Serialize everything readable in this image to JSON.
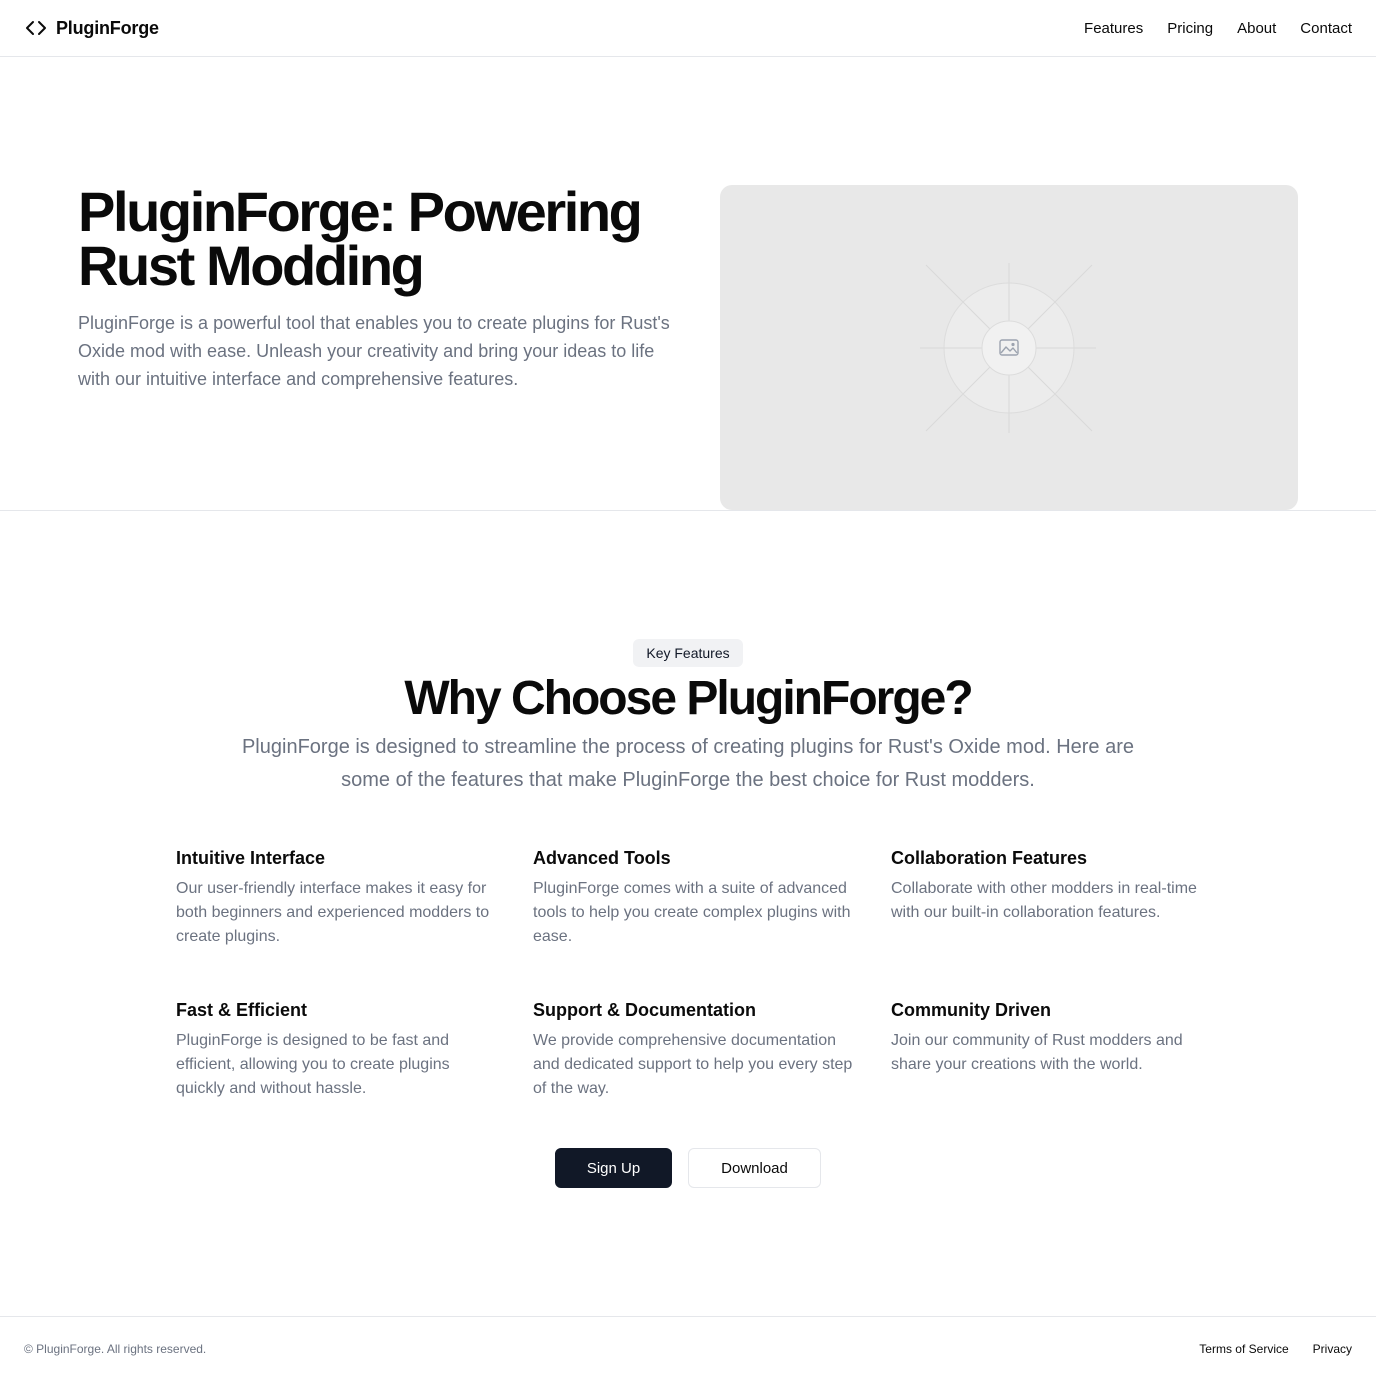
{
  "header": {
    "brand_icon": "code-brackets-icon",
    "brand_name": "PluginForge",
    "nav": [
      {
        "label": "Features"
      },
      {
        "label": "Pricing"
      },
      {
        "label": "About"
      },
      {
        "label": "Contact"
      }
    ]
  },
  "hero": {
    "title": "PluginForge: Powering Rust Modding",
    "description": "PluginForge is a powerful tool that enables you to create plugins for Rust's Oxide mod with ease. Unleash your creativity and bring your ideas to life with our intuitive interface and comprehensive features.",
    "image_icon": "image-placeholder-icon"
  },
  "features_section": {
    "badge": "Key Features",
    "title": "Why Choose PluginForge?",
    "description": "PluginForge is designed to streamline the process of creating plugins for Rust's Oxide mod. Here are some of the features that make PluginForge the best choice for Rust modders.",
    "items": [
      {
        "title": "Intuitive Interface",
        "text": "Our user-friendly interface makes it easy for both beginners and experienced modders to create plugins."
      },
      {
        "title": "Advanced Tools",
        "text": "PluginForge comes with a suite of advanced tools to help you create complex plugins with ease."
      },
      {
        "title": "Collaboration Features",
        "text": "Collaborate with other modders in real-time with our built-in collaboration features."
      },
      {
        "title": "Fast & Efficient",
        "text": "PluginForge is designed to be fast and efficient, allowing you to create plugins quickly and without hassle."
      },
      {
        "title": "Support & Documentation",
        "text": "We provide comprehensive documentation and dedicated support to help you every step of the way."
      },
      {
        "title": "Community Driven",
        "text": "Join our community of Rust modders and share your creations with the world."
      }
    ],
    "primary_button": "Sign Up",
    "secondary_button": "Download"
  },
  "footer": {
    "copyright": "© PluginForge. All rights reserved.",
    "links": [
      {
        "label": "Terms of Service"
      },
      {
        "label": "Privacy"
      }
    ]
  }
}
